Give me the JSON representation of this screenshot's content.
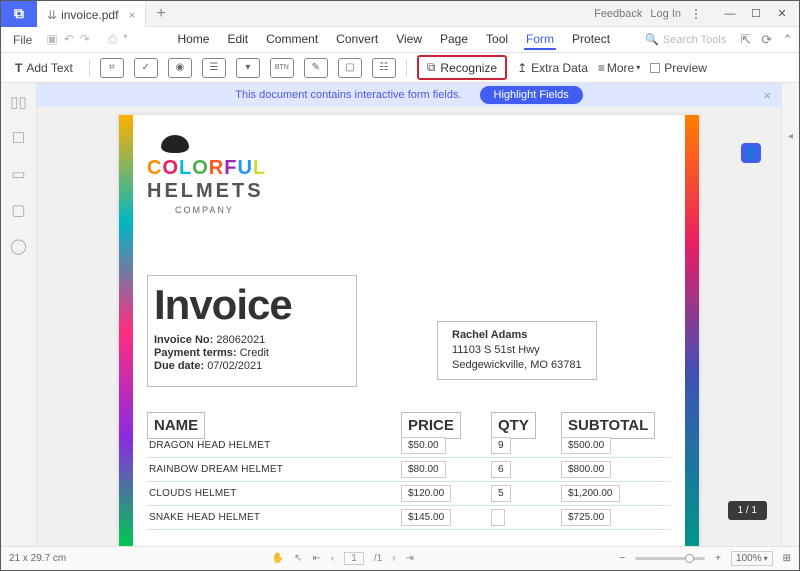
{
  "titlebar": {
    "tab_label": "invoice.pdf",
    "feedback": "Feedback",
    "login": "Log In"
  },
  "menubar": {
    "file": "File",
    "items": [
      "Home",
      "Edit",
      "Comment",
      "Convert",
      "View",
      "Page",
      "Tool",
      "Form",
      "Protect"
    ],
    "active_index": 7,
    "search_placeholder": "Search Tools"
  },
  "toolbar": {
    "addtext": "Add Text",
    "recognize": "Recognize",
    "extradata": "Extra Data",
    "more": "More",
    "preview": "Preview"
  },
  "banner": {
    "text": "This document contains interactive form fields.",
    "button": "Highlight Fields"
  },
  "doc": {
    "brand_letters": [
      "C",
      "O",
      "L",
      "O",
      "R",
      "F",
      "U",
      "L"
    ],
    "brand2": "HELMETS",
    "company": "COMPANY",
    "invoice_title": "Invoice",
    "meta": {
      "invno_label": "Invoice No:",
      "invno_val": "28062021",
      "terms_label": "Payment terms:",
      "terms_val": "Credit",
      "due_label": "Due date:",
      "due_val": "07/02/2021"
    },
    "billto": {
      "name": "Rachel Adams",
      "line1": "11103 S 51st Hwy",
      "line2": "Sedgewickville, MO 63781"
    },
    "headers": {
      "name": "NAME",
      "price": "PRICE",
      "qty": "QTY",
      "sub": "SUBTOTAL"
    },
    "rows": [
      {
        "name": "DRAGON HEAD HELMET",
        "price": "$50.00",
        "qty": "9",
        "sub": "$500.00"
      },
      {
        "name": "RAINBOW DREAM HELMET",
        "price": "$80.00",
        "qty": "6",
        "sub": "$800.00"
      },
      {
        "name": "CLOUDS HELMET",
        "price": "$120.00",
        "qty": "5",
        "sub": "$1,200.00"
      },
      {
        "name": "SNAKE HEAD HELMET",
        "price": "$145.00",
        "qty": "",
        "sub": "$725.00"
      }
    ]
  },
  "page_badge": "1 / 1",
  "status": {
    "dims": "21 x 29.7 cm",
    "page_current": "1",
    "page_total": "/1",
    "zoom": "100%"
  }
}
